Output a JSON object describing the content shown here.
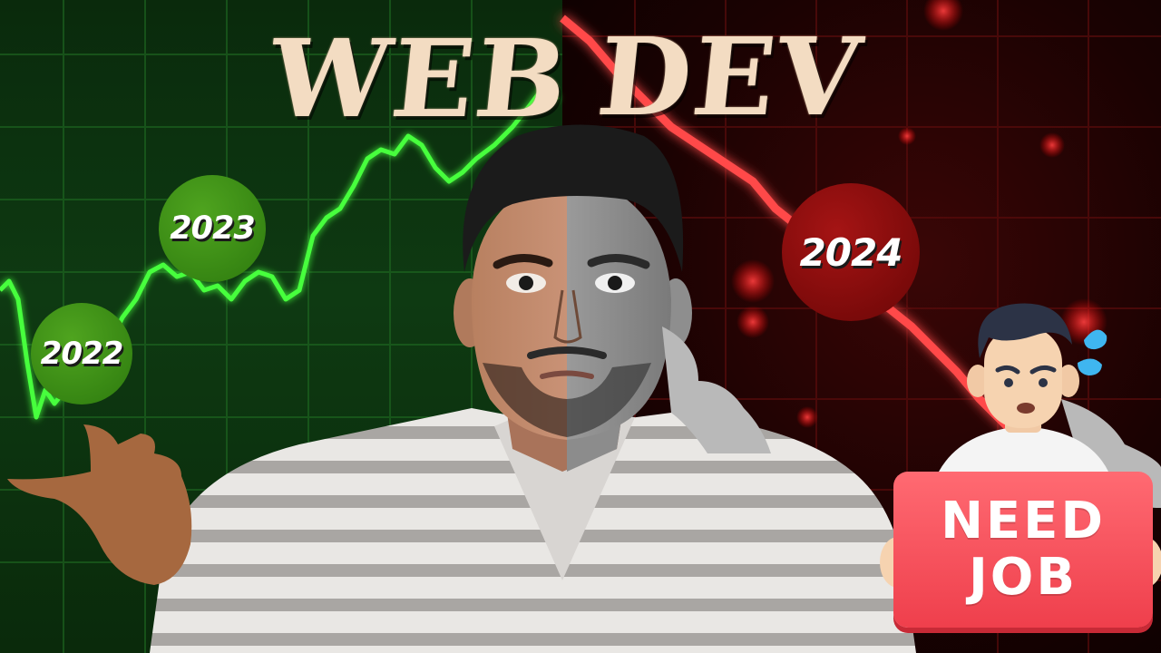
{
  "title": {
    "word_1": "WEB",
    "word_2": "DEV"
  },
  "years": {
    "y2022": "2022",
    "y2023": "2023",
    "y2024": "2024"
  },
  "sign": {
    "line_1": "NEED",
    "line_2": "JOB"
  },
  "colors": {
    "left_bg": "#0e3a12",
    "right_bg": "#2a0404",
    "green_line": "#3dff3a",
    "red_line": "#ff3b3b",
    "title_text": "#f3dcc2",
    "badge_green": "#3b8f16",
    "badge_red": "#8a0b0b",
    "sign_red": "#f4505a"
  },
  "icons": {
    "person": "man-portrait-photo",
    "cartoon": "worried-cartoon-man-icon",
    "sweat": "sweat-drops-icon"
  }
}
